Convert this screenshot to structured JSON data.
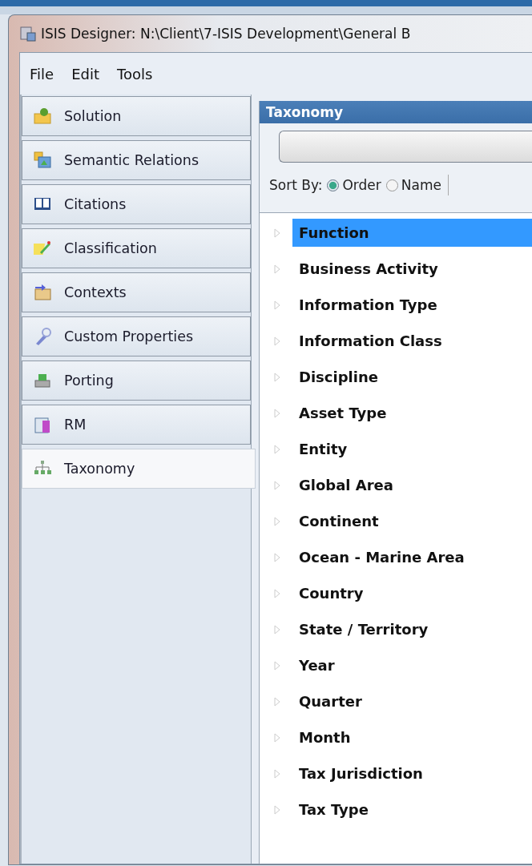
{
  "window": {
    "title": "ISIS Designer: N:\\Client\\7-ISIS Development\\General B"
  },
  "menu": [
    "File",
    "Edit",
    "Tools"
  ],
  "sidebar": {
    "items": [
      {
        "label": "Solution",
        "selected": false
      },
      {
        "label": "Semantic Relations",
        "selected": false
      },
      {
        "label": "Citations",
        "selected": false
      },
      {
        "label": "Classification",
        "selected": false
      },
      {
        "label": "Contexts",
        "selected": false
      },
      {
        "label": "Custom Properties",
        "selected": false
      },
      {
        "label": "Porting",
        "selected": false
      },
      {
        "label": "RM",
        "selected": false
      },
      {
        "label": "Taxonomy",
        "selected": true
      }
    ]
  },
  "panel": {
    "title": "Taxonomy",
    "sort": {
      "label": "Sort By:",
      "options": [
        {
          "label": "Order",
          "selected": true
        },
        {
          "label": "Name",
          "selected": false
        }
      ]
    },
    "tree": [
      {
        "label": "Function",
        "selected": true,
        "expanded": false
      },
      {
        "label": "Business Activity",
        "selected": false,
        "expanded": false
      },
      {
        "label": "Information Type",
        "selected": false,
        "expanded": false
      },
      {
        "label": "Information Class",
        "selected": false,
        "expanded": false
      },
      {
        "label": "Discipline",
        "selected": false,
        "expanded": false
      },
      {
        "label": "Asset Type",
        "selected": false,
        "expanded": false
      },
      {
        "label": "Entity",
        "selected": false,
        "expanded": false
      },
      {
        "label": "Global Area",
        "selected": false,
        "expanded": false
      },
      {
        "label": "Continent",
        "selected": false,
        "expanded": false
      },
      {
        "label": "Ocean - Marine Area",
        "selected": false,
        "expanded": false
      },
      {
        "label": "Country",
        "selected": false,
        "expanded": false
      },
      {
        "label": "State / Territory",
        "selected": false,
        "expanded": false
      },
      {
        "label": "Year",
        "selected": false,
        "expanded": false
      },
      {
        "label": "Quarter",
        "selected": false,
        "expanded": false
      },
      {
        "label": "Month",
        "selected": false,
        "expanded": false
      },
      {
        "label": "Tax Jurisdiction",
        "selected": false,
        "expanded": false
      },
      {
        "label": "Tax Type",
        "selected": false,
        "expanded": false
      }
    ]
  }
}
